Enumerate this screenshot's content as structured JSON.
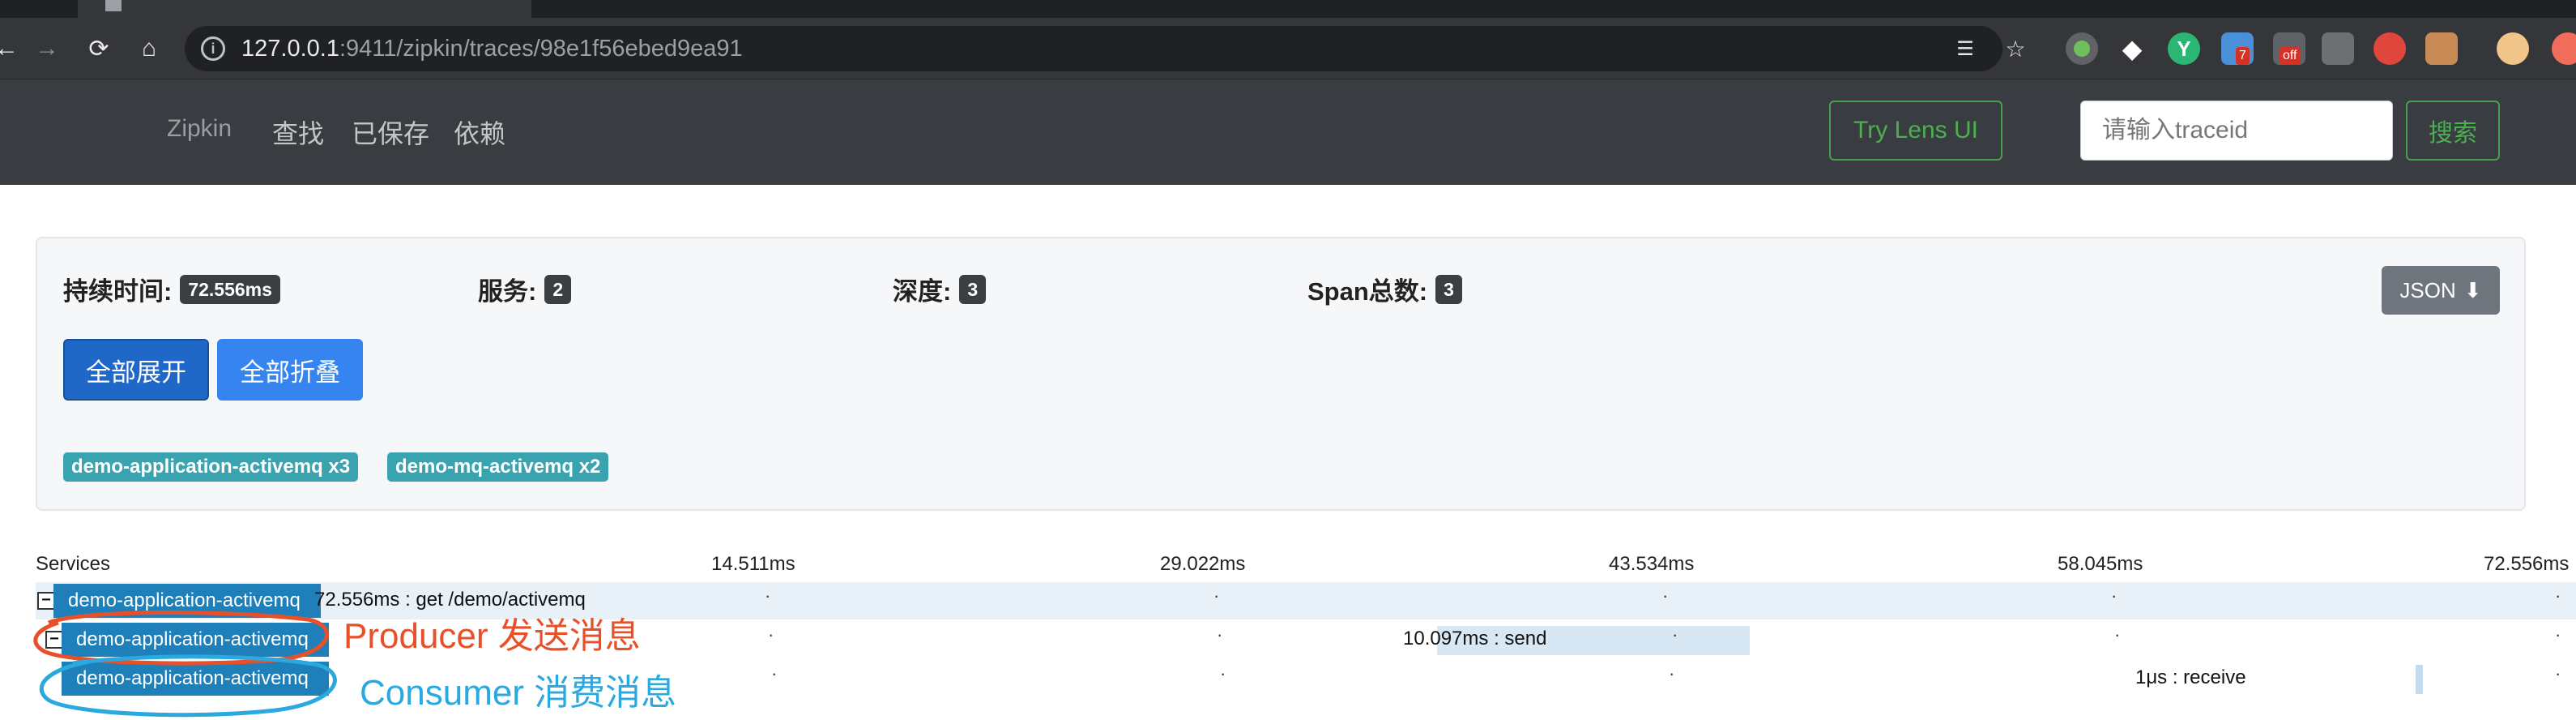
{
  "browser": {
    "url_host": "127.0.0.1",
    "url_rest": ":9411/zipkin/traces/98e1f56ebed9ea91",
    "extension_badges": [
      "7",
      "off"
    ]
  },
  "navbar": {
    "brand": "Zipkin",
    "links": [
      "查找",
      "已保存",
      "依赖"
    ],
    "lens_button": "Try Lens UI",
    "traceid_placeholder": "请输入traceid",
    "search_button": "搜索"
  },
  "summary": {
    "duration_label": "持续时间:",
    "duration_value": "72.556ms",
    "services_label": "服务:",
    "services_value": "2",
    "depth_label": "深度:",
    "depth_value": "3",
    "span_count_label": "Span总数:",
    "span_count_value": "3",
    "json_button": "JSON",
    "expand_all": "全部展开",
    "collapse_all": "全部折叠",
    "service_tags": [
      "demo-application-activemq x3",
      "demo-mq-activemq x2"
    ]
  },
  "timeline": {
    "services_header": "Services",
    "ticks": [
      "14.511ms",
      "29.022ms",
      "43.534ms",
      "58.045ms",
      "72.556ms"
    ],
    "rows": [
      {
        "service": "demo-application-activemq",
        "label": "72.556ms : get /demo/activemq",
        "start_pct": 0,
        "duration_pct": 100,
        "toggle": "−"
      },
      {
        "service": "demo-application-activemq",
        "label": "10.097ms : send",
        "start_pct": 49.6,
        "duration_pct": 13.9,
        "toggle": "−"
      },
      {
        "service": "demo-application-activemq",
        "label": "1μs : receive",
        "start_pct": 93.1,
        "duration_pct": 0.3,
        "toggle": ""
      }
    ]
  },
  "annotations": {
    "producer": "Producer 发送消息",
    "consumer": "Consumer 消费消息",
    "producer_color": "#e8502a",
    "consumer_color": "#2aa8e0"
  }
}
